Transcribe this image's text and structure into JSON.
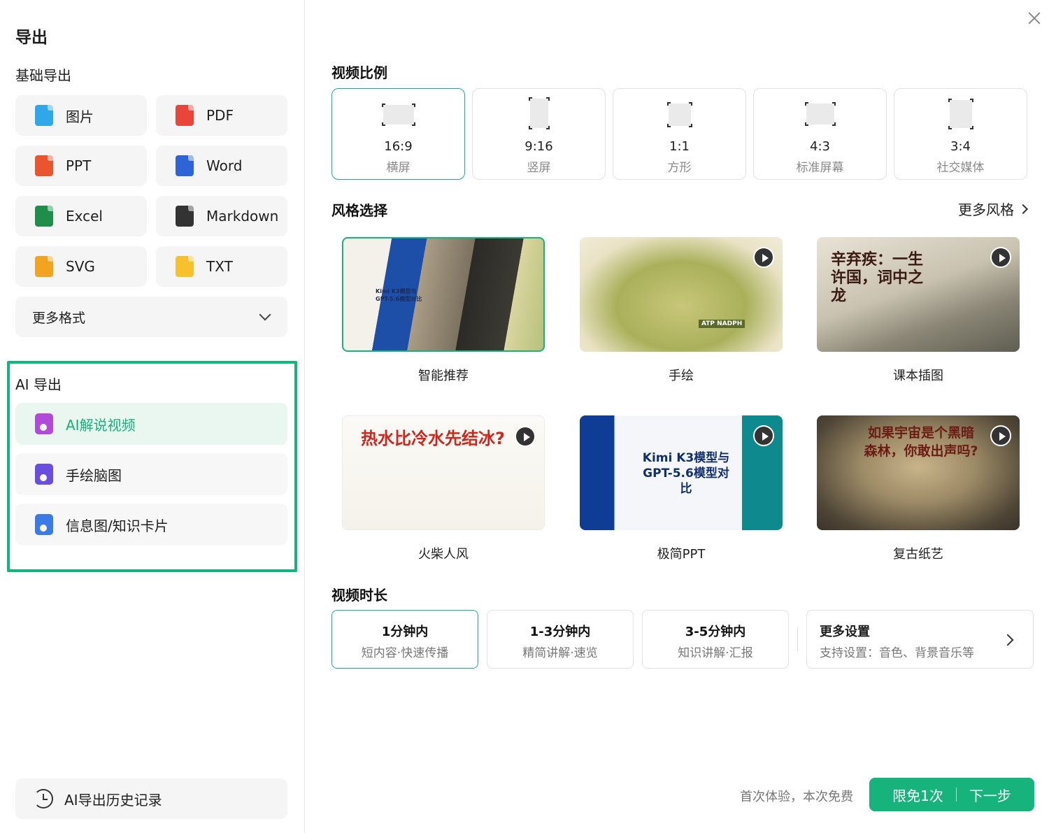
{
  "sidebar": {
    "title": "导出",
    "basic_label": "基础导出",
    "formats": [
      {
        "label": "图片",
        "icon": "image-icon",
        "color": "#2fa7e8"
      },
      {
        "label": "PDF",
        "icon": "pdf-icon",
        "color": "#e9453b"
      },
      {
        "label": "PPT",
        "icon": "ppt-icon",
        "color": "#e8552e"
      },
      {
        "label": "Word",
        "icon": "word-icon",
        "color": "#2f64d9"
      },
      {
        "label": "Excel",
        "icon": "excel-icon",
        "color": "#1e8e4a"
      },
      {
        "label": "Markdown",
        "icon": "markdown-icon",
        "color": "#333333"
      },
      {
        "label": "SVG",
        "icon": "svg-icon",
        "color": "#f2a320"
      },
      {
        "label": "TXT",
        "icon": "txt-icon",
        "color": "#f6c12c"
      }
    ],
    "more_formats": "更多格式",
    "ai_label": "AI 导出",
    "ai_items": [
      {
        "label": "AI解说视频",
        "icon": "video-icon",
        "color": "#b14ad8",
        "active": true
      },
      {
        "label": "手绘脑图",
        "icon": "mindmap-icon",
        "color": "#6a4ee0",
        "active": false
      },
      {
        "label": "信息图/知识卡片",
        "icon": "infographic-icon",
        "color": "#3a7be8",
        "active": false
      }
    ],
    "history": "AI导出历史记录"
  },
  "main": {
    "ratio_title": "视频比例",
    "ratios": [
      {
        "value": "16:9",
        "label": "横屏",
        "active": true
      },
      {
        "value": "9:16",
        "label": "竖屏",
        "active": false
      },
      {
        "value": "1:1",
        "label": "方形",
        "active": false
      },
      {
        "value": "4:3",
        "label": "标准屏幕",
        "active": false
      },
      {
        "value": "3:4",
        "label": "社交媒体",
        "active": false
      }
    ],
    "style_title": "风格选择",
    "more_styles": "更多风格",
    "styles": [
      {
        "label": "智能推荐",
        "active": true,
        "thumb_text": "Kimi K3模型与 GPT-5.6模型对比"
      },
      {
        "label": "手绘",
        "active": false,
        "thumb_text": "ATP NADPH"
      },
      {
        "label": "课本插图",
        "active": false,
        "thumb_text": "辛弃疾：一生许国，词中之龙"
      },
      {
        "label": "火柴人风",
        "active": false,
        "thumb_text": "热水比冷水先结冰?"
      },
      {
        "label": "极简PPT",
        "active": false,
        "thumb_text": "Kimi K3模型与 GPT-5.6模型对比"
      },
      {
        "label": "复古纸艺",
        "active": false,
        "thumb_text": "如果宇宙是个黑暗森林，你敢出声吗?"
      }
    ],
    "duration_title": "视频时长",
    "durations": [
      {
        "title": "1分钟内",
        "sub": "短内容·快速传播",
        "active": true
      },
      {
        "title": "1-3分钟内",
        "sub": "精简讲解·速览",
        "active": false
      },
      {
        "title": "3-5分钟内",
        "sub": "知识讲解·汇报",
        "active": false
      }
    ],
    "more_settings_title": "更多设置",
    "more_settings_sub": "支持设置：音色、背景音乐等",
    "free_note": "首次体验，本次免费",
    "next_left": "限免1次",
    "next_right": "下一步"
  },
  "colors": {
    "accent": "#16b47c"
  }
}
